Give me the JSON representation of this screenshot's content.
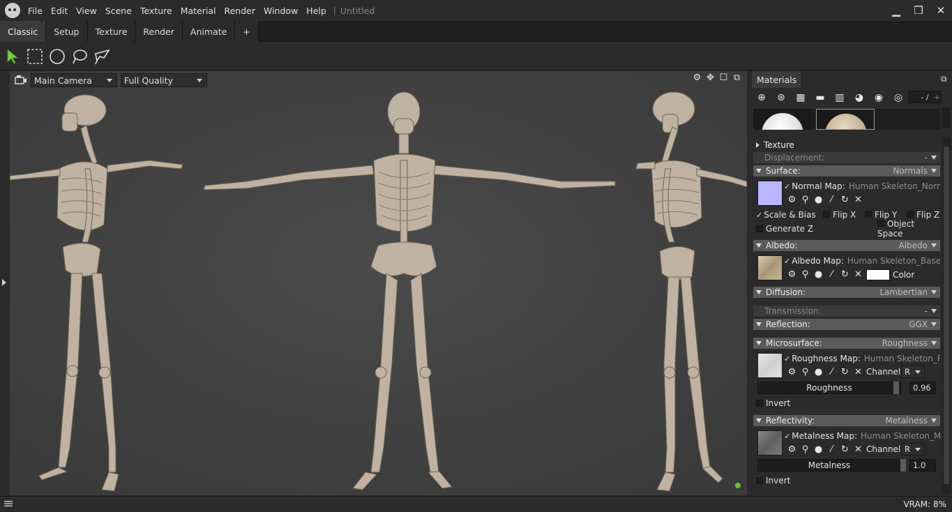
{
  "menubar": {
    "items": [
      "File",
      "Edit",
      "View",
      "Scene",
      "Texture",
      "Material",
      "Render",
      "Window",
      "Help"
    ],
    "separator": "|",
    "doc_title": "Untitled",
    "controls": {
      "minimize": "▁",
      "maximize": "❐",
      "close": "✕"
    }
  },
  "tabs": [
    "Classic",
    "Setup",
    "Texture",
    "Render",
    "Animate",
    "+"
  ],
  "viewport": {
    "camera": "Main Camera",
    "quality": "Full Quality"
  },
  "panel": {
    "tab_label": "Materials",
    "counter": "- /",
    "counter_plus": "+",
    "sections": {
      "texture": "Texture",
      "displacement": {
        "label": "Displacement:",
        "mode": "-"
      },
      "surface": {
        "label": "Surface:",
        "mode": "Normals"
      },
      "normal_map": {
        "label": "Normal Map:",
        "file": "Human Skeleton_Normal."
      },
      "scale_bias": "Scale & Bias",
      "flip_x": "Flip X",
      "flip_y": "Flip Y",
      "flip_z": "Flip Z",
      "generate_z": "Generate Z",
      "object_space": "Object Space",
      "albedo": {
        "label": "Albedo:",
        "mode": "Albedo"
      },
      "albedo_map": {
        "label": "Albedo Map:",
        "file": "Human Skeleton_Base_col"
      },
      "albedo_color_label": "Color",
      "diffusion": {
        "label": "Diffusion:",
        "mode": "Lambertian"
      },
      "transmission": {
        "label": "Transmission:",
        "mode": "-"
      },
      "reflection": {
        "label": "Reflection:",
        "mode": "GGX"
      },
      "microsurface": {
        "label": "Microsurface:",
        "mode": "Roughness"
      },
      "roughness_map": {
        "label": "Roughness Map:",
        "file": "Human Skeleton_Roug"
      },
      "roughness_channel_label": "Channel",
      "roughness_channel": "R",
      "roughness_slider_label": "Roughness",
      "roughness_value": "0.96",
      "roughness_invert": "Invert",
      "reflectivity": {
        "label": "Reflectivity:",
        "mode": "Metalness"
      },
      "metalness_map": {
        "label": "Metalness Map:",
        "file": "Human Skeleton_Metal"
      },
      "metalness_channel_label": "Channel",
      "metalness_channel": "R",
      "metalness_slider_label": "Metalness",
      "metalness_value": "1.0",
      "metalness_invert": "Invert"
    }
  },
  "status": {
    "vram": "VRAM: 8%"
  },
  "colors": {
    "accent_green": "#6bbf3a",
    "viewport_bg": "#434343",
    "header_bg": "#5a5a5a",
    "normal_swatch": "#b8b6ff",
    "bone": "#bfb2a2"
  }
}
